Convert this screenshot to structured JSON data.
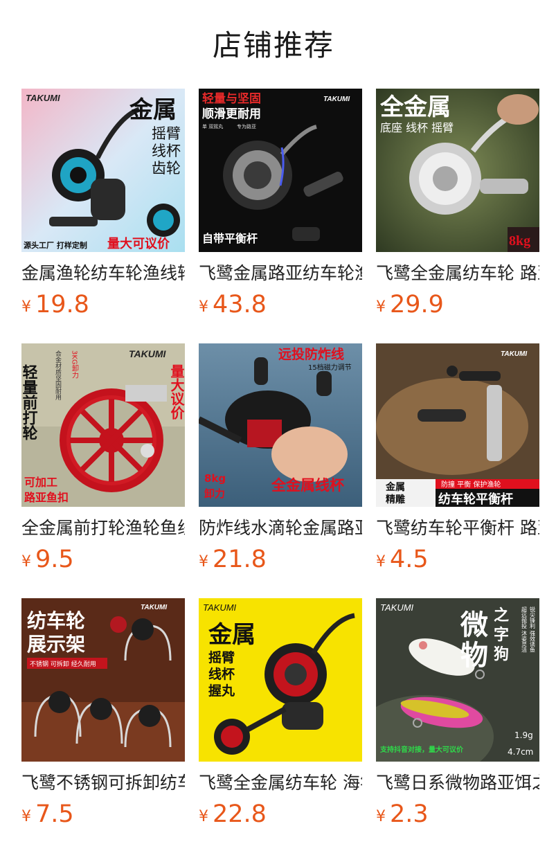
{
  "section": {
    "title": "店铺推荐"
  },
  "products": [
    {
      "title": "金属渔轮纺车轮渔线轮",
      "currency": "¥",
      "price": "19.8",
      "image_text": {
        "brand": "TAKUMI",
        "headline": "金属",
        "lines": [
          "摇臂",
          "线杯",
          "齿轮"
        ],
        "footer_left": "源头工厂  打样定制",
        "footer_right": "量大可议价"
      }
    },
    {
      "title": "飞鹭金属路亚纺车轮渔线轮",
      "currency": "¥",
      "price": "43.8",
      "image_text": {
        "brand": "TAKUMI",
        "headline": "轻量与坚固",
        "sub": "顺滑更耐用",
        "small_left": "单  双摇丸",
        "small_right": "专为路亚",
        "footer": "自带平衡杆"
      }
    },
    {
      "title": "飞鹭全金属纺车轮 路亚轮",
      "currency": "¥",
      "price": "29.9",
      "image_text": {
        "headline": "全金属",
        "sub": "底座 线杯 摇臂",
        "badge": "8kg"
      }
    },
    {
      "title": "全金属前打轮渔轮鱼线轮",
      "currency": "¥",
      "price": "9.5",
      "image_text": {
        "brand": "TAKUMI",
        "headline": "轻量前打轮",
        "badge": "3KG卸力",
        "side_note": "合金材质坚固耐用",
        "right_text": "量大议价",
        "footer1": "可加工",
        "footer2": "路亚鱼扣"
      }
    },
    {
      "title": "防炸线水滴轮金属路亚轮",
      "currency": "¥",
      "price": "21.8",
      "image_text": {
        "headline": "远投防炸线",
        "sub": "15档磁力调节",
        "badge1": "8kg",
        "badge2": "卸力",
        "footer": "全金属线杯"
      }
    },
    {
      "title": "飞鹭纺车轮平衡杆 路亚配件",
      "currency": "¥",
      "price": "4.5",
      "image_text": {
        "brand": "TAKUMI",
        "left1": "金属",
        "left2": "精雕",
        "tags": "防撞  平衡  保护渔轮",
        "footer": "纺车轮平衡杆"
      }
    },
    {
      "title": "飞鹭不锈钢可拆卸纺车轮展示架",
      "currency": "¥",
      "price": "7.5",
      "image_text": {
        "brand": "TAKUMI",
        "headline1": "纺车轮",
        "headline2": "展示架",
        "tag": "不锈钢 可拆卸 经久耐用"
      }
    },
    {
      "title": "飞鹭全金属纺车轮 海竿轮",
      "currency": "¥",
      "price": "22.8",
      "image_text": {
        "brand": "TAKUMI",
        "headline": "金属",
        "lines": [
          "摇臂",
          "线杯",
          "握丸"
        ]
      }
    },
    {
      "title": "飞鹭日系微物路亚饵之字狗",
      "currency": "¥",
      "price": "2.3",
      "image_text": {
        "brand": "TAKUMI",
        "big1": "微",
        "big2": "物",
        "small1": "之",
        "small2": "字",
        "small3": "狗",
        "vertical1": "超远抛投 沐姿灵活",
        "vertical2": "锐尖锋利 强效诱鱼",
        "weight": "1.9g",
        "length": "4.7cm",
        "footer": "支持抖音对接，量大可议价"
      }
    }
  ],
  "colors": {
    "price": "#e8571a",
    "title": "#222222",
    "heading": "#1a1a1a"
  }
}
